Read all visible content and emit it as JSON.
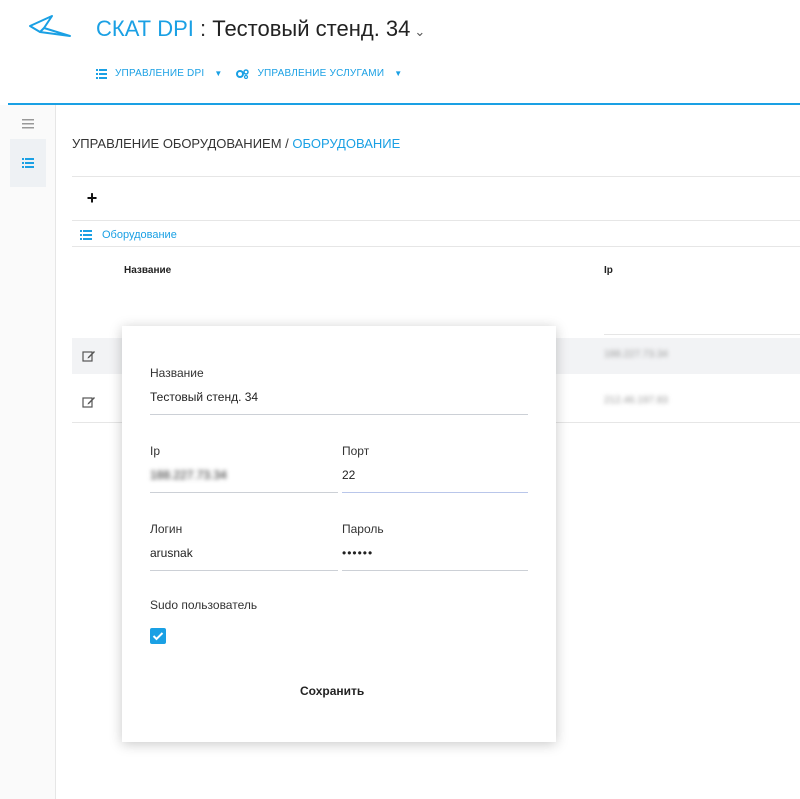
{
  "header": {
    "brand": "СКАТ DPI",
    "separator": " : ",
    "stand_name": "Тестовый стенд. 34",
    "stand_chevron": "⌄"
  },
  "topnav": {
    "items": [
      {
        "label": "УПРАВЛЕНИЕ DPI",
        "icon": "list-icon"
      },
      {
        "label": "УПРАВЛЕНИЕ УСЛУГАМИ",
        "icon": "gears-icon"
      }
    ]
  },
  "breadcrumb": {
    "parent": "УПРАВЛЕНИЕ ОБОРУДОВАНИЕМ",
    "separator": " / ",
    "current": "ОБОРУДОВАНИЕ"
  },
  "toolbar": {
    "add_label": "+"
  },
  "section": {
    "title": "Оборудование"
  },
  "table": {
    "columns": [
      "Название",
      "Ip"
    ],
    "rows": [
      {
        "ip": "188.227.73.34"
      },
      {
        "ip": "212.46.197.83"
      }
    ]
  },
  "popup": {
    "name_label": "Название",
    "name_value": "Тестовый стенд. 34",
    "ip_label": "Ip",
    "ip_value": "188.227.73.34",
    "port_label": "Порт",
    "port_value": "22",
    "login_label": "Логин",
    "login_value": "arusnak",
    "password_label": "Пароль",
    "password_value": "••••••",
    "sudo_label": "Sudo пользователь",
    "sudo_checked": true,
    "save_label": "Сохранить"
  },
  "colors": {
    "accent": "#1aa0e4",
    "header_line": "#1aa0e4",
    "row_highlight": "#f2f3f5"
  }
}
